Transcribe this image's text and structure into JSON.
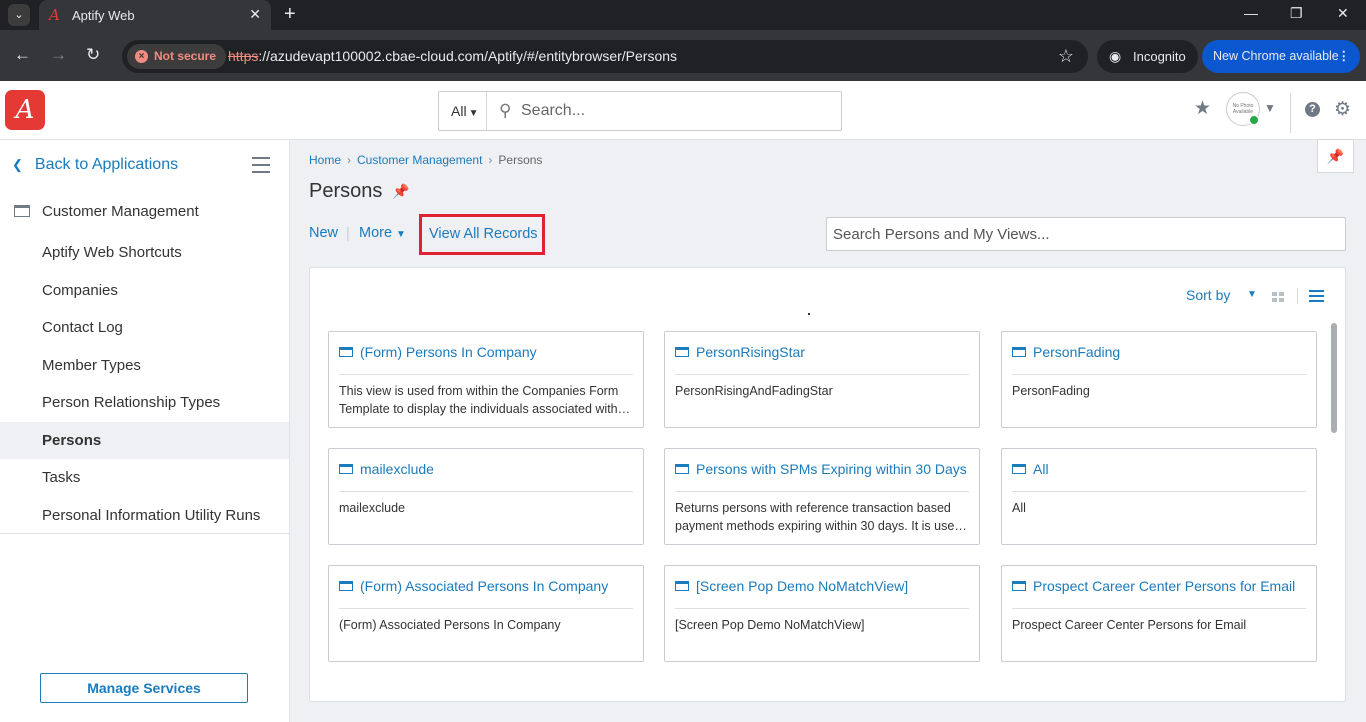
{
  "browser": {
    "tab_title": "Aptify Web",
    "tab_close": "✕",
    "new_tab": "+",
    "not_secure": "Not secure",
    "url_scheme": "https",
    "url_rest": "://azudevapt100002.cbae-cloud.com/Aptify/#/entitybrowser/Persons",
    "incognito": "Incognito",
    "new_chrome": "New Chrome available"
  },
  "header": {
    "logo_text": "A",
    "search_scope": "All",
    "search_placeholder": "Search...",
    "avatar_text": "No Photo Available"
  },
  "sidebar": {
    "back_label": "Back to Applications",
    "section_label": "Customer Management",
    "items": [
      {
        "label": "Aptify Web Shortcuts",
        "active": false
      },
      {
        "label": "Companies",
        "active": false
      },
      {
        "label": "Contact Log",
        "active": false
      },
      {
        "label": "Member Types",
        "active": false
      },
      {
        "label": "Person Relationship Types",
        "active": false
      },
      {
        "label": "Persons",
        "active": true
      },
      {
        "label": "Tasks",
        "active": false
      },
      {
        "label": "Personal Information Utility Runs",
        "active": false
      }
    ],
    "manage_services": "Manage Services"
  },
  "main": {
    "breadcrumb": [
      "Home",
      "Customer Management",
      "Persons"
    ],
    "title": "Persons",
    "actions": {
      "new": "New",
      "more": "More",
      "view_all": "View All Records"
    },
    "view_search_placeholder": "Search Persons and My Views...",
    "sort_by": "Sort by",
    "cards": [
      {
        "title": "(Form) Persons In Company",
        "desc": "This view is used from within the Companies Form Template to display the individuals associated with the company."
      },
      {
        "title": "PersonRisingStar",
        "desc": "PersonRisingAndFadingStar"
      },
      {
        "title": "PersonFading",
        "desc": "PersonFading"
      },
      {
        "title": "mailexclude",
        "desc": "mailexclude"
      },
      {
        "title": "Persons with SPMs Expiring within 30 Days",
        "desc": "Returns persons with reference transaction based payment methods expiring within 30 days. It is used for notifications."
      },
      {
        "title": "All",
        "desc": "All"
      },
      {
        "title": "(Form) Associated Persons In Company",
        "desc": "(Form) Associated Persons In Company"
      },
      {
        "title": "[Screen Pop Demo NoMatchView]",
        "desc": "[Screen Pop Demo NoMatchView]"
      },
      {
        "title": "Prospect Career Center Persons for Email",
        "desc": "Prospect Career Center Persons for Email"
      }
    ]
  },
  "colors": {
    "brand_red": "#e53935",
    "link_blue": "#1a7bbd",
    "highlight_red": "#e0212f"
  }
}
